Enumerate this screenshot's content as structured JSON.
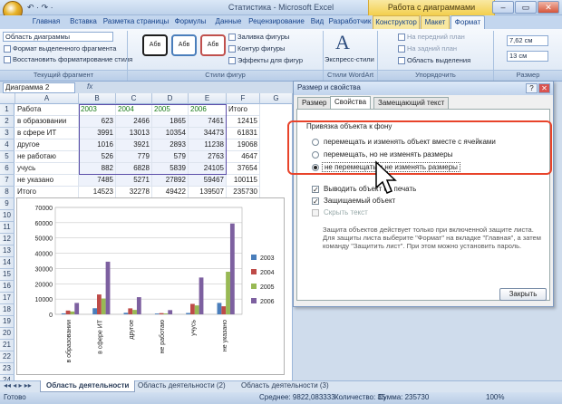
{
  "window": {
    "title": "Статистика - Microsoft Excel",
    "context_header": "Работа с диаграммами",
    "min": "–",
    "max": "▭",
    "close": "✕"
  },
  "qat": "↶ · ↷ ·",
  "tabs": [
    "Главная",
    "Вставка",
    "Разметка страницы",
    "Формулы",
    "Данные",
    "Рецензирование",
    "Вид",
    "Разработчик",
    "Конструктор",
    "Макет",
    "Формат"
  ],
  "ribbon": {
    "current_fragment": {
      "dropdown": "Область диаграммы",
      "format_selected": "Формат выделенного фрагмента",
      "restore_style": "Восстановить форматирование стиля",
      "label": "Текущий фрагмент"
    },
    "shape_styles": {
      "samples": [
        "Абв",
        "Абв",
        "Абв"
      ],
      "fill": "Заливка фигуры",
      "outline": "Контур фигуры",
      "effects": "Эффекты для фигур",
      "label": "Стили фигур"
    },
    "wordart": {
      "express": "Экспресс-стили",
      "label": "Стили WordArt"
    },
    "arrange": {
      "front": "На передний план",
      "back": "На задний план",
      "selection_pane": "Область выделения",
      "label": "Упорядочить"
    },
    "size": {
      "height": "7,62 см",
      "width": "13 см",
      "label": "Размер"
    }
  },
  "namebox": "Диаграмма 2",
  "fx": "fx",
  "columns": [
    "A",
    "B",
    "C",
    "D",
    "E",
    "F",
    "G"
  ],
  "rows": [
    "1",
    "2",
    "3",
    "4",
    "5",
    "6",
    "7",
    "8",
    "9",
    "10",
    "11",
    "12",
    "13",
    "14",
    "15",
    "16",
    "17",
    "18",
    "19",
    "20",
    "21",
    "22",
    "23",
    "24"
  ],
  "table": {
    "header": [
      "Работа",
      "2003",
      "2004",
      "2005",
      "2006",
      "Итого"
    ],
    "data": [
      [
        "в образовании",
        "623",
        "2466",
        "1865",
        "7461",
        "12415"
      ],
      [
        "в сфере ИТ",
        "3991",
        "13013",
        "10354",
        "34473",
        "61831"
      ],
      [
        "другое",
        "1016",
        "3921",
        "2893",
        "11238",
        "19068"
      ],
      [
        "не работаю",
        "526",
        "779",
        "579",
        "2763",
        "4647"
      ],
      [
        "учусь",
        "882",
        "6828",
        "5839",
        "24105",
        "37654"
      ],
      [
        "не указано",
        "7485",
        "5271",
        "27892",
        "59467",
        "100115"
      ],
      [
        "Итого",
        "14523",
        "32278",
        "49422",
        "139507",
        "235730"
      ]
    ]
  },
  "chart_data": {
    "type": "bar",
    "categories": [
      "в образовании",
      "в сфере ИТ",
      "другое",
      "не работаю",
      "учусь",
      "не указано"
    ],
    "series": [
      {
        "name": "2003",
        "values": [
          623,
          3991,
          1016,
          526,
          882,
          7485
        ],
        "color": "#4a7ebb"
      },
      {
        "name": "2004",
        "values": [
          2466,
          13013,
          3921,
          779,
          6828,
          5271
        ],
        "color": "#be4b48"
      },
      {
        "name": "2005",
        "values": [
          1865,
          10354,
          2893,
          579,
          5839,
          27892
        ],
        "color": "#98b954"
      },
      {
        "name": "2006",
        "values": [
          7461,
          34473,
          11238,
          2763,
          24105,
          59467
        ],
        "color": "#7d60a0"
      }
    ],
    "ylim": [
      0,
      70000
    ],
    "yticks": [
      "70000",
      "60000",
      "50000",
      "40000",
      "30000",
      "20000",
      "10000",
      "0"
    ],
    "legend": "right",
    "grid": true
  },
  "dialog": {
    "title": "Размер и свойства",
    "help": "?",
    "close": "✕",
    "tabs": [
      "Размер",
      "Свойства",
      "Замещающий текст"
    ],
    "anchor_label": "Привязка объекта к фону",
    "options": [
      "перемещать и изменять объект вместе с ячейками",
      "перемещать, но не изменять размеры",
      "не перемещать и не изменять размеры"
    ],
    "selected": 2,
    "checks": [
      {
        "label": "Выводить объект на печать",
        "checked": true
      },
      {
        "label": "Защищаемый объект",
        "checked": true
      },
      {
        "label": "Скрыть текст",
        "checked": false
      }
    ],
    "note": "Защита объектов действует только при включенной защите листа. Для защиты листа выберите \"Формат\" на вкладке \"Главная\", а затем команду \"Защитить лист\". При этом можно установить пароль.",
    "close_button": "Закрыть"
  },
  "sheets": [
    "Область деятельности",
    "Область деятельности (2)",
    "Область деятельности (3)"
  ],
  "status": {
    "ready": "Готово",
    "average": "Среднее: 9822,083333",
    "count": "Количество: 35",
    "sum": "Сумма: 235730",
    "zoom": "100%"
  }
}
